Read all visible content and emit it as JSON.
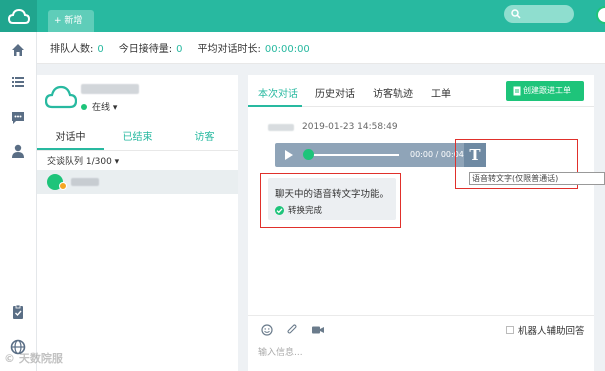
{
  "topbar": {
    "new_tab_label": "+ 新增",
    "accent_color": "#28b9a0"
  },
  "stats": {
    "queue_label": "排队人数:",
    "queue_value": "0",
    "today_label": "今日接待量:",
    "today_value": "0",
    "avg_label": "平均对话时长:",
    "avg_value": "00:00:00"
  },
  "agent": {
    "status": "在线 ▾"
  },
  "left_tabs": [
    "对话中",
    "已结束",
    "访客"
  ],
  "queue_text": "交谈队列 1/300 ▾",
  "right_tabs": [
    "本次对话",
    "历史对话",
    "访客轨迹",
    "工单"
  ],
  "create_ticket_label": "创建跟进工单",
  "message": {
    "time": "2019-01-23 14:58:49",
    "player_time": "00:00 / 00:04",
    "transcribe_button": "T",
    "tooltip": "语音转文字(仅限普通话)",
    "text": "聊天中的语音转文字功能。",
    "status": "转换完成"
  },
  "input": {
    "robot_assist": "机器人辅助回答",
    "placeholder": "输入信息..."
  },
  "watermark": "© 天数院服",
  "icons": [
    "home-icon",
    "list-icon",
    "chat-icon",
    "user-icon",
    "clipboard-icon",
    "globe-icon",
    "search-icon",
    "play-icon",
    "volume-icon",
    "emoji-icon",
    "attachment-icon",
    "video-icon",
    "check-icon",
    "ticket-icon",
    "cloud-logo-icon"
  ]
}
